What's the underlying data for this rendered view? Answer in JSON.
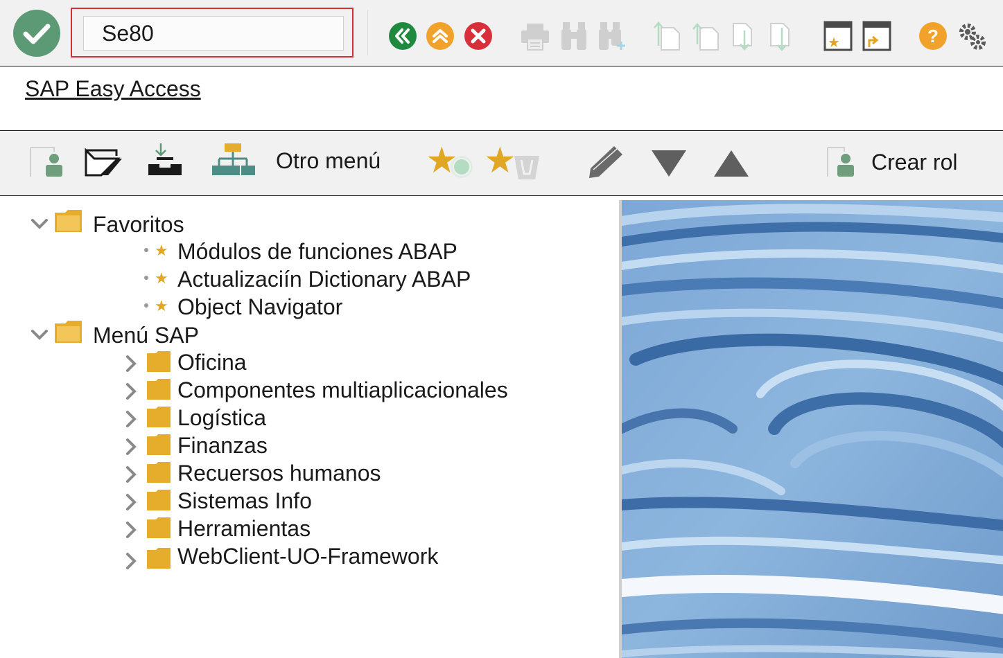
{
  "command_field": {
    "value": "Se80"
  },
  "title": "SAP Easy Access",
  "app_toolbar": {
    "other_menu": "Otro menú",
    "create_role": "Crear rol"
  },
  "tree": {
    "favorites": {
      "label": "Favoritos",
      "items": [
        "Módulos de funciones ABAP",
        "Actualizaciín Dictionary ABAP",
        "Object Navigator"
      ]
    },
    "sap_menu": {
      "label": "Menú SAP",
      "items": [
        "Oficina",
        "Componentes multiaplicacionales",
        "Logística",
        "Finanzas",
        "Recuersos humanos",
        "Sistemas Info",
        "Herramientas",
        "WebClient-UO-Framework"
      ]
    }
  },
  "colors": {
    "confirm_green": "#5b9a74",
    "back_green": "#1f8a3e",
    "up_orange": "#f0a22a",
    "cancel_red": "#d8303a",
    "help_orange": "#f0a22a",
    "folder_yellow": "#e6ac2c",
    "role_green": "#6f9e7c",
    "highlight_red": "#d0302f"
  }
}
